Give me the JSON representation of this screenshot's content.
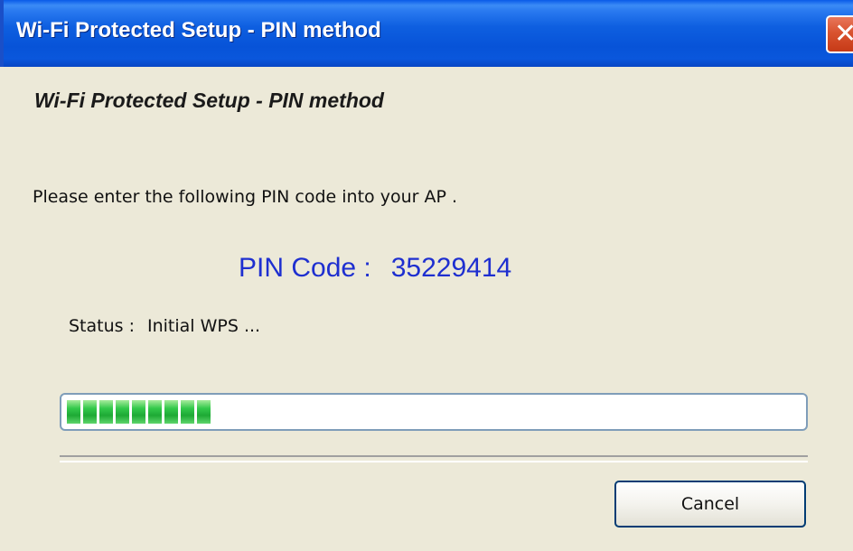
{
  "window": {
    "title": "Wi-Fi Protected Setup - PIN method",
    "close_glyph": "✕"
  },
  "content": {
    "heading": "Wi-Fi Protected Setup - PIN method",
    "instruction": "Please enter the following PIN code into your AP .",
    "pin_label": "PIN Code :",
    "pin_value": "35229414",
    "status_label": "Status :",
    "status_value": "Initial WPS ..."
  },
  "progress": {
    "filled_segments": 9,
    "percent": 20,
    "color": "#1ea935"
  },
  "buttons": {
    "cancel": "Cancel"
  },
  "colors": {
    "titlebar": "#0753d8",
    "pin_text": "#1e2fd0",
    "dialog_bg": "#ece9d8"
  },
  "icons": {
    "close": "close-icon"
  }
}
